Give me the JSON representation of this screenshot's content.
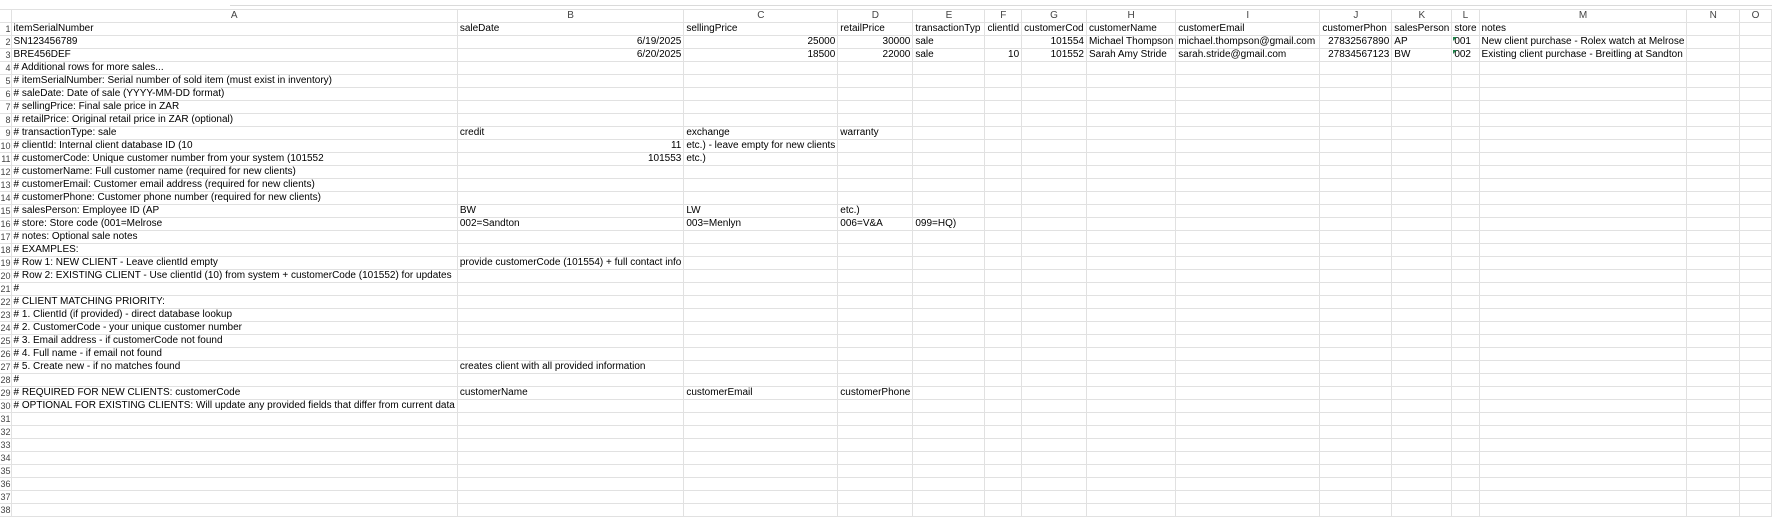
{
  "columns": [
    "A",
    "B",
    "C",
    "D",
    "E",
    "F",
    "G",
    "H",
    "I",
    "J",
    "K",
    "L",
    "M",
    "N",
    "O"
  ],
  "row_numbers": [
    "1",
    "2",
    "3",
    "4",
    "5",
    "6",
    "7",
    "8",
    "9",
    "10",
    "11",
    "12",
    "13",
    "14",
    "15",
    "16",
    "17",
    "18",
    "19",
    "20",
    "21",
    "22",
    "23",
    "24",
    "25",
    "26",
    "27",
    "28",
    "29",
    "30",
    "31",
    "32",
    "33",
    "34",
    "35",
    "36",
    "37",
    "38"
  ],
  "header": {
    "A": "itemSerialNumber",
    "B": "saleDate",
    "C": "sellingPrice",
    "D": "retailPrice",
    "E": "transactionTyp",
    "F": "clientId",
    "G": "customerCod",
    "H": "customerName",
    "I": "customerEmail",
    "J": "customerPhon",
    "K": "salesPerson",
    "L": "store",
    "M": "notes"
  },
  "row2": {
    "A": "SN123456789",
    "B": "6/19/2025",
    "C": "25000",
    "D": "30000",
    "E": "sale",
    "G": "101554",
    "H": "Michael Thompson",
    "I": "michael.thompson@gmail.com",
    "J": "27832567890",
    "K": "AP",
    "L": "001",
    "M": "New client purchase - Rolex watch at Melrose"
  },
  "row3": {
    "A": "BRE456DEF",
    "B": "6/20/2025",
    "C": "18500",
    "D": "22000",
    "E": "sale",
    "F": "10",
    "G": "101552",
    "H": "Sarah Amy Stride",
    "I": "sarah.stride@gmail.com",
    "J": "27834567123",
    "K": "BW",
    "L": "002",
    "M": "Existing client purchase - Breitling at Sandton"
  },
  "notes": {
    "r4A": "# Additional rows for more sales...",
    "r5A": "# itemSerialNumber: Serial number of sold item (must exist in inventory)",
    "r6A": "# saleDate: Date of sale (YYYY-MM-DD format)",
    "r7A": "# sellingPrice: Final sale price in ZAR",
    "r8A": "# retailPrice: Original retail price in ZAR (optional)",
    "r9A": "# transactionType: sale",
    "r9B": "credit",
    "r9C": "exchange",
    "r9D": "warranty",
    "r10A": "# clientId: Internal client database ID (10",
    "r10B": "11",
    "r10C": "etc.) - leave empty for new clients",
    "r11A": "# customerCode: Unique customer number from your system (101552",
    "r11B": "101553",
    "r11C": "etc.)",
    "r12A": "# customerName: Full customer name (required for new clients)",
    "r13A": "# customerEmail: Customer email address (required for new clients)",
    "r14A": "# customerPhone: Customer phone number (required for new clients)",
    "r15A": "# salesPerson: Employee ID (AP",
    "r15B": "BW",
    "r15C": "LW",
    "r15D": "etc.)",
    "r16A": "# store: Store code (001=Melrose",
    "r16B": "002=Sandton",
    "r16C": "003=Menlyn",
    "r16D": "006=V&A",
    "r16E": "099=HQ)",
    "r17A": "# notes: Optional sale notes",
    "r18A": "# EXAMPLES:",
    "r19A": "# Row 1: NEW CLIENT - Leave clientId empty",
    "r19B": "provide customerCode (101554) + full contact info",
    "r20A": "# Row 2: EXISTING CLIENT - Use clientId (10) from system + customerCode (101552) for updates",
    "r21A": "#",
    "r22A": "# CLIENT MATCHING PRIORITY:",
    "r23A": "# 1. ClientId (if provided) - direct database lookup",
    "r24A": "# 2. CustomerCode - your unique customer number",
    "r25A": "# 3. Email address - if customerCode not found",
    "r26A": "# 4. Full name - if email not found",
    "r27A": "# 5. Create new - if no matches found",
    "r27B": "creates client with all provided information",
    "r28A": "#",
    "r29A": "# REQUIRED FOR NEW CLIENTS: customerCode",
    "r29B": "customerName",
    "r29C": "customerEmail",
    "r29D": "customerPhone",
    "r30A": "# OPTIONAL FOR EXISTING CLIENTS: Will update any provided fields that differ from current data"
  },
  "colors": {
    "grid": "#e1e1e1",
    "header_text": "#444444",
    "flag": "#1e8449"
  }
}
